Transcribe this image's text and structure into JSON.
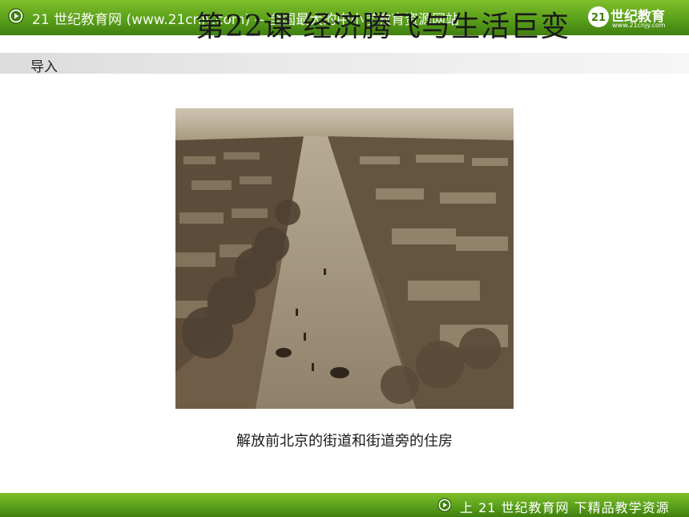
{
  "header": {
    "site_text": "21 世纪教育网 (www.21cnjy.com) -- 全国最大的中小学教育资源网站",
    "title": "第22课 经济腾飞与生活巨变",
    "logo_main": "世纪教育",
    "logo_sub": "www.21cnjy.com"
  },
  "section": {
    "label": "导入"
  },
  "photo": {
    "caption": "解放前北京的街道和街道旁的住房"
  },
  "footer": {
    "slogan": "上 21 世纪教育网  下精品教学资源"
  },
  "colors": {
    "banner_green": "#5aa01a",
    "section_gray": "#e0e0e0",
    "photo_sepia": "#7d6a52"
  }
}
